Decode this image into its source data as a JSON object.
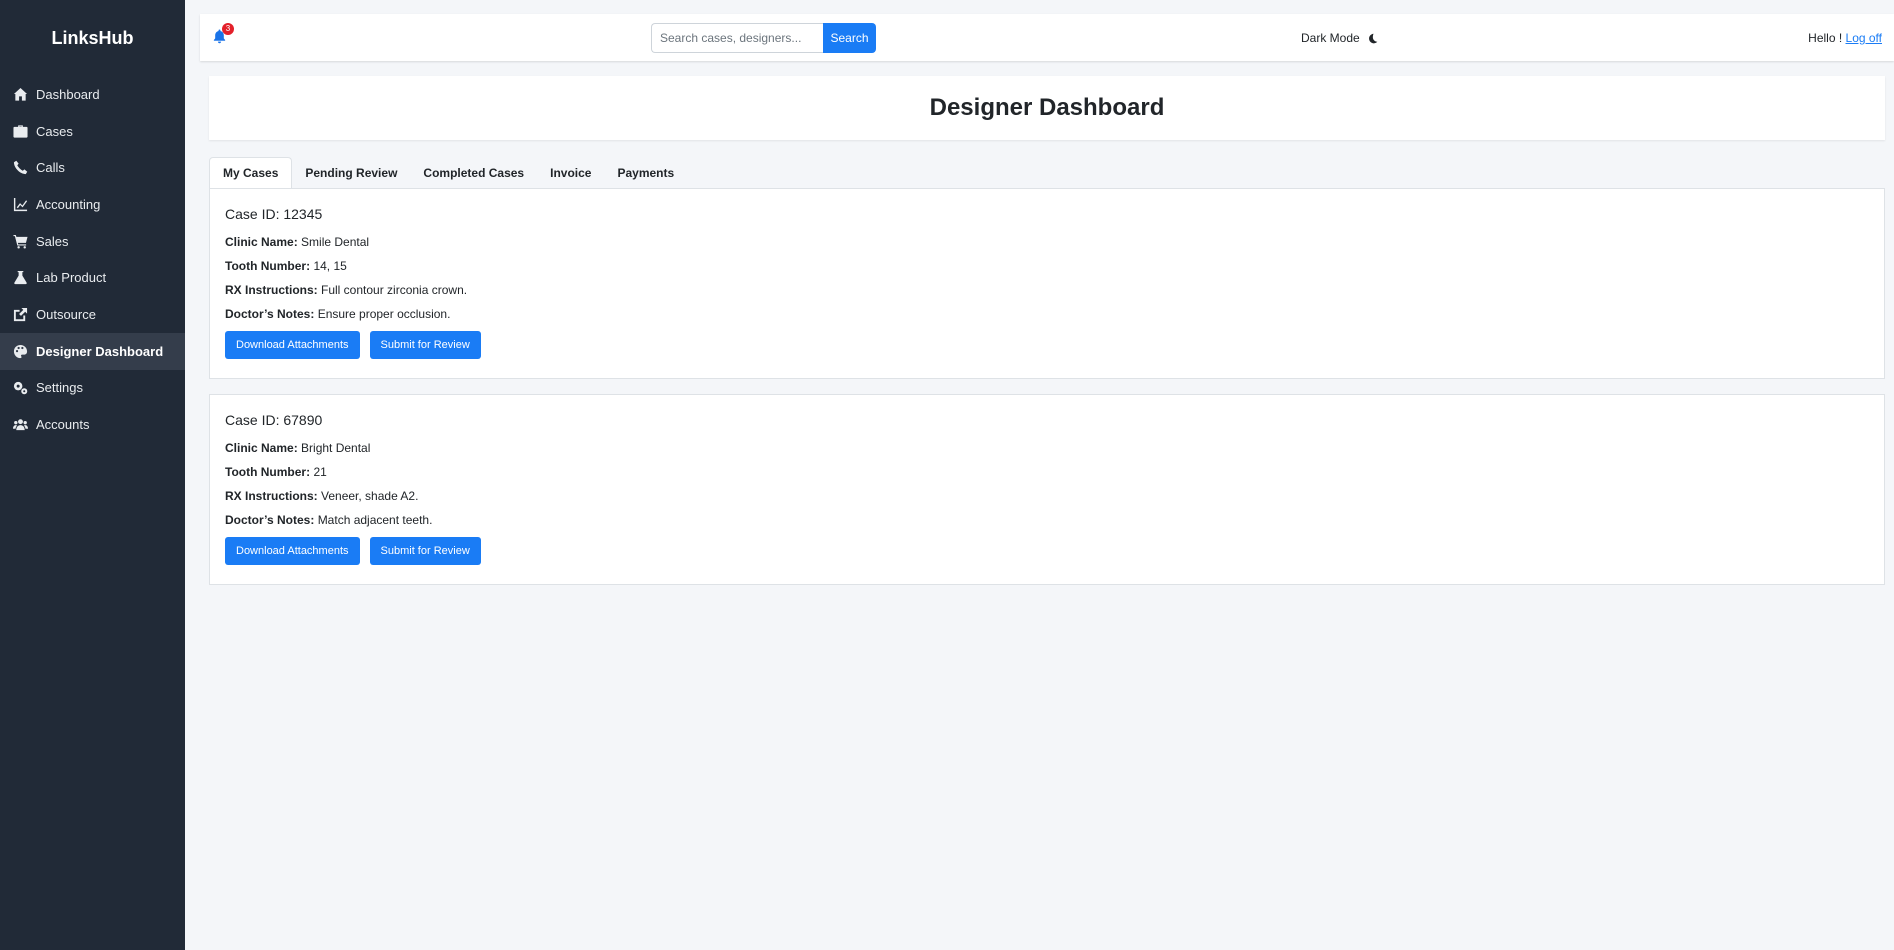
{
  "app": {
    "brand": "LinksHub"
  },
  "sidebar": {
    "items": [
      {
        "label": "Dashboard",
        "icon": "home-icon",
        "active": false
      },
      {
        "label": "Cases",
        "icon": "briefcase-icon",
        "active": false
      },
      {
        "label": "Calls",
        "icon": "phone-icon",
        "active": false
      },
      {
        "label": "Accounting",
        "icon": "chart-line-icon",
        "active": false
      },
      {
        "label": "Sales",
        "icon": "cart-icon",
        "active": false
      },
      {
        "label": "Lab Product",
        "icon": "flask-icon",
        "active": false
      },
      {
        "label": "Outsource",
        "icon": "external-link-icon",
        "active": false
      },
      {
        "label": "Designer Dashboard",
        "icon": "palette-icon",
        "active": true
      },
      {
        "label": "Settings",
        "icon": "gears-icon",
        "active": false
      },
      {
        "label": "Accounts",
        "icon": "users-icon",
        "active": false
      }
    ]
  },
  "topbar": {
    "notification_count": "3",
    "search_placeholder": "Search cases, designers...",
    "search_button": "Search",
    "dark_mode_label": "Dark Mode",
    "greeting": "Hello !",
    "logoff": "Log off"
  },
  "page": {
    "title": "Designer Dashboard"
  },
  "tabs": [
    {
      "label": "My Cases",
      "active": true
    },
    {
      "label": "Pending Review",
      "active": false
    },
    {
      "label": "Completed Cases",
      "active": false
    },
    {
      "label": "Invoice",
      "active": false
    },
    {
      "label": "Payments",
      "active": false
    }
  ],
  "field_labels": {
    "clinic": "Clinic Name:",
    "tooth": "Tooth Number:",
    "rx": "RX Instructions:",
    "notes": "Doctor’s Notes:"
  },
  "cases": [
    {
      "title": "Case ID: 12345",
      "clinic": "Smile Dental",
      "tooth": "14, 15",
      "rx": "Full contour zirconia crown.",
      "notes": "Ensure proper occlusion.",
      "download_label": "Download Attachments",
      "submit_label": "Submit for Review"
    },
    {
      "title": "Case ID: 67890",
      "clinic": "Bright Dental",
      "tooth": "21",
      "rx": "Veneer, shade A2.",
      "notes": "Match adjacent teeth.",
      "download_label": "Download Attachments",
      "submit_label": "Submit for Review"
    }
  ],
  "colors": {
    "sidebar_bg": "#212a37",
    "accent": "#1a7cf5",
    "badge": "#e3202a",
    "page_bg": "#f4f6f9"
  }
}
